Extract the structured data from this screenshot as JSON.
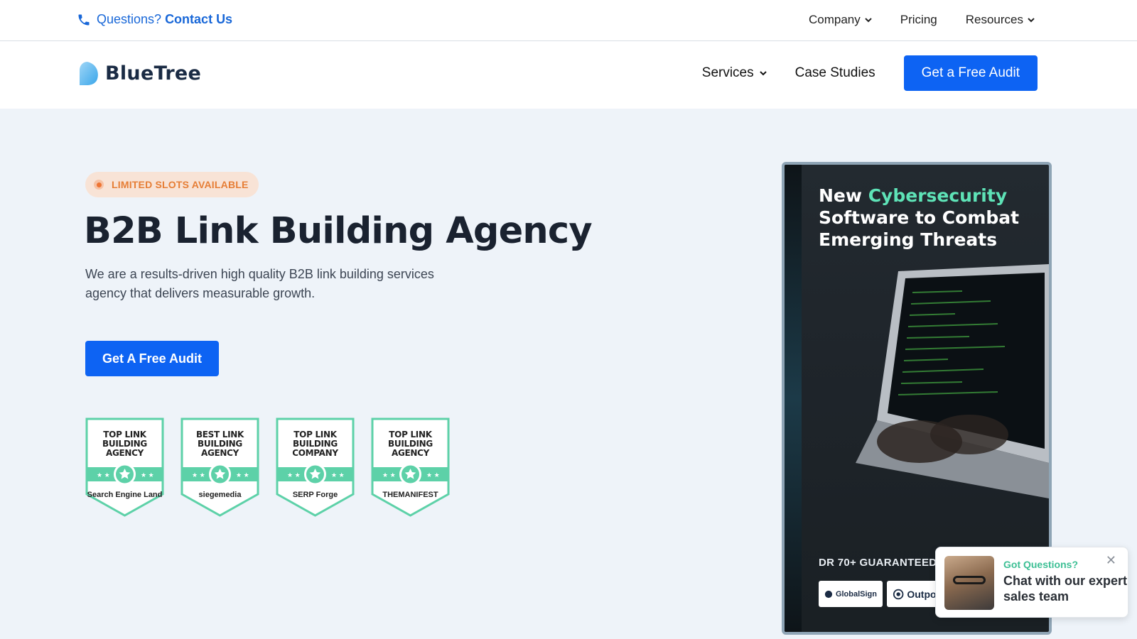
{
  "topbar": {
    "contact_prefix": "Questions?",
    "contact_link": "Contact Us",
    "nav": [
      "Company",
      "Pricing",
      "Resources"
    ]
  },
  "brand": {
    "name": "BlueTree"
  },
  "mainnav": {
    "services": "Services",
    "case_studies": "Case Studies",
    "cta": "Get a Free Audit"
  },
  "hero": {
    "badge": "LIMITED SLOTS AVAILABLE",
    "title": "B2B Link Building Agency",
    "description": "We are a results-driven high quality B2B link building services agency that delivers measurable growth.",
    "cta": "Get A Free Audit"
  },
  "awards": [
    {
      "line1": "TOP LINK",
      "line2": "BUILDING",
      "line3": "AGENCY",
      "source": "Search Engine Land"
    },
    {
      "line1": "BEST LINK",
      "line2": "BUILDING",
      "line3": "AGENCY",
      "source": "siegemedia"
    },
    {
      "line1": "TOP LINK",
      "line2": "BUILDING",
      "line3": "COMPANY",
      "source": "SERP Forge"
    },
    {
      "line1": "TOP LINK",
      "line2": "BUILDING",
      "line3": "AGENCY",
      "source": "THEMANIFEST"
    }
  ],
  "promo": {
    "title_new": "New",
    "title_accent": "Cybersecurity",
    "title_rest": "Software to Combat Emerging Threats",
    "dr_text": "DR 70+ GUARANTEED",
    "logos": [
      "GlobalSign",
      "Outpost"
    ]
  },
  "chat": {
    "eyebrow": "Got Questions?",
    "message": "Chat with our expert sales team",
    "close": "✕"
  },
  "colors": {
    "primary": "#0d63f3",
    "accent_teal": "#5ee3b7",
    "badge_orange": "#e67e36",
    "hero_bg": "#eef3f9"
  }
}
